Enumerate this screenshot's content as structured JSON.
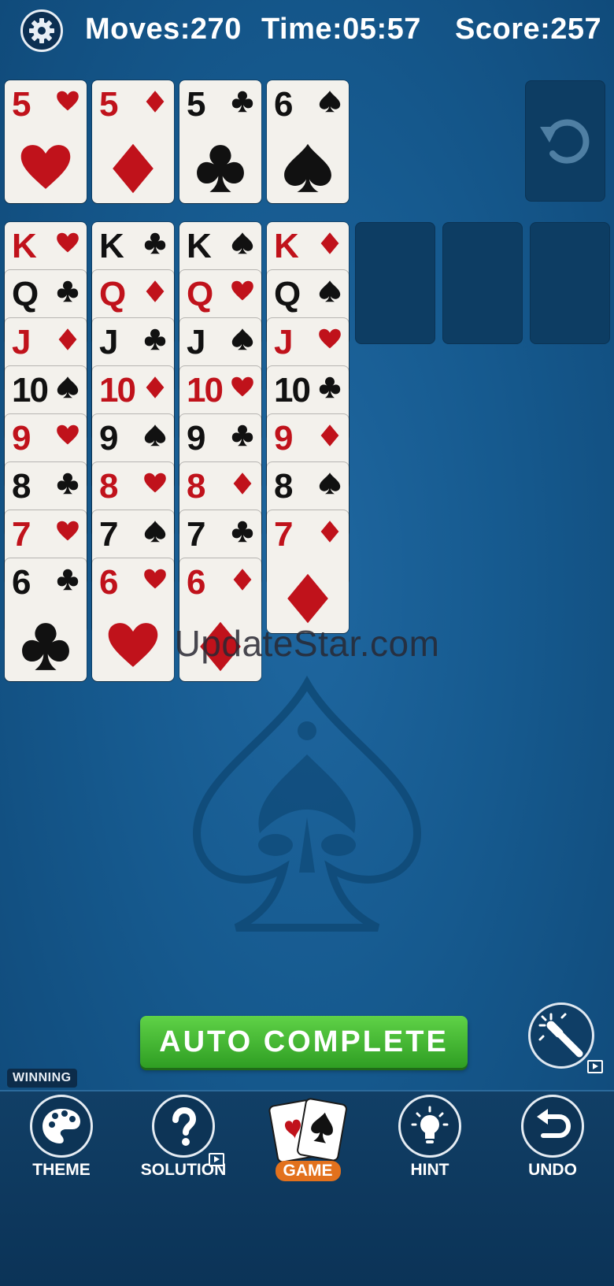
{
  "header": {
    "moves_label": "Moves:",
    "moves_value": "270",
    "time_label": "Time:",
    "time_value": "05:57",
    "score_label": "Score:",
    "score_value": "257"
  },
  "foundations": [
    {
      "rank": "5",
      "suit": "hearts"
    },
    {
      "rank": "5",
      "suit": "diamonds"
    },
    {
      "rank": "5",
      "suit": "clubs"
    },
    {
      "rank": "6",
      "suit": "spades"
    }
  ],
  "tableau": [
    [
      {
        "rank": "K",
        "suit": "hearts"
      },
      {
        "rank": "Q",
        "suit": "clubs"
      },
      {
        "rank": "J",
        "suit": "diamonds"
      },
      {
        "rank": "10",
        "suit": "spades"
      },
      {
        "rank": "9",
        "suit": "hearts"
      },
      {
        "rank": "8",
        "suit": "clubs"
      },
      {
        "rank": "7",
        "suit": "hearts"
      },
      {
        "rank": "6",
        "suit": "clubs"
      }
    ],
    [
      {
        "rank": "K",
        "suit": "clubs"
      },
      {
        "rank": "Q",
        "suit": "diamonds"
      },
      {
        "rank": "J",
        "suit": "clubs"
      },
      {
        "rank": "10",
        "suit": "diamonds"
      },
      {
        "rank": "9",
        "suit": "spades"
      },
      {
        "rank": "8",
        "suit": "hearts"
      },
      {
        "rank": "7",
        "suit": "spades"
      },
      {
        "rank": "6",
        "suit": "hearts"
      }
    ],
    [
      {
        "rank": "K",
        "suit": "spades"
      },
      {
        "rank": "Q",
        "suit": "hearts"
      },
      {
        "rank": "J",
        "suit": "spades"
      },
      {
        "rank": "10",
        "suit": "hearts"
      },
      {
        "rank": "9",
        "suit": "clubs"
      },
      {
        "rank": "8",
        "suit": "diamonds"
      },
      {
        "rank": "7",
        "suit": "clubs"
      },
      {
        "rank": "6",
        "suit": "diamonds"
      }
    ],
    [
      {
        "rank": "K",
        "suit": "diamonds"
      },
      {
        "rank": "Q",
        "suit": "spades"
      },
      {
        "rank": "J",
        "suit": "hearts"
      },
      {
        "rank": "10",
        "suit": "clubs"
      },
      {
        "rank": "9",
        "suit": "diamonds"
      },
      {
        "rank": "8",
        "suit": "spades"
      },
      {
        "rank": "7",
        "suit": "diamonds"
      }
    ]
  ],
  "empty_slots": 3,
  "watermark": "UpdateStar.com",
  "auto_complete_label": "AUTO COMPLETE",
  "winning_badge": "WINNING",
  "nav": {
    "theme": "THEME",
    "solution": "SOLUTION",
    "game": "GAME",
    "hint": "HINT",
    "undo": "UNDO"
  },
  "colors": {
    "felt": "#165a8f",
    "red_suit": "#c0121b",
    "black_suit": "#111111",
    "auto_button": "#3fb22f",
    "game_label": "#e2711d"
  },
  "icons": {
    "settings": "gear-icon",
    "redeal": "refresh-icon",
    "magic": "magic-wand-icon",
    "theme": "palette-icon",
    "solution": "question-icon",
    "game": "cards-icon",
    "hint": "lightbulb-icon",
    "undo": "undo-icon"
  }
}
